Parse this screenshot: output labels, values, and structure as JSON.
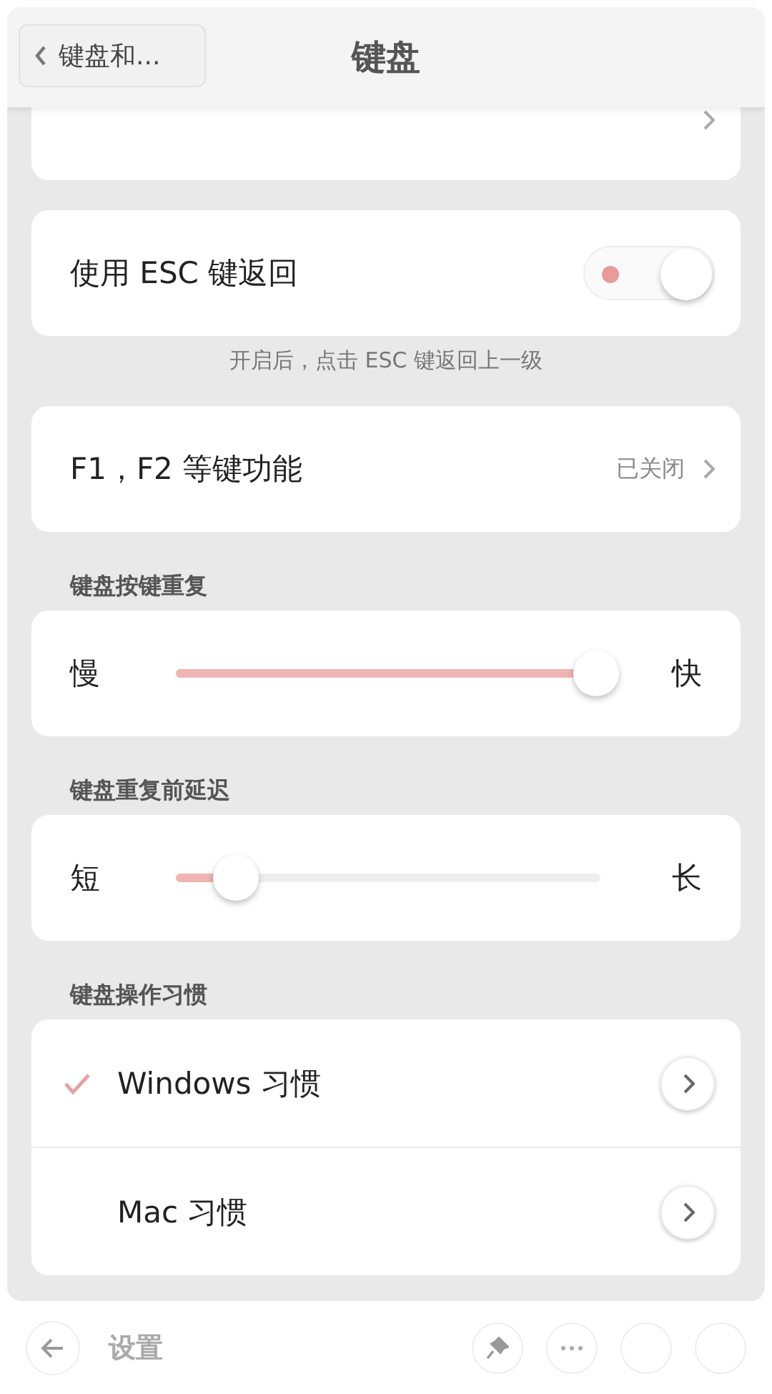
{
  "header": {
    "back_label": "键盘和...",
    "title": "键盘"
  },
  "esc_row": {
    "label": "使用 ESC 键返回",
    "on": true,
    "hint": "开启后，点击 ESC 键返回上一级"
  },
  "fkey_row": {
    "label": "F1，F2 等键功能",
    "value": "已关闭"
  },
  "sliders": [
    {
      "section": "键盘按键重复",
      "min_label": "慢",
      "max_label": "快",
      "level": 0.99
    },
    {
      "section": "键盘重复前延迟",
      "min_label": "短",
      "max_label": "长",
      "level": 0.14
    }
  ],
  "habits": {
    "section": "键盘操作习惯",
    "items": [
      {
        "label": "Windows 习惯",
        "selected": true
      },
      {
        "label": "Mac 习惯",
        "selected": false
      }
    ]
  },
  "bottom_bar": {
    "title": "设置"
  }
}
